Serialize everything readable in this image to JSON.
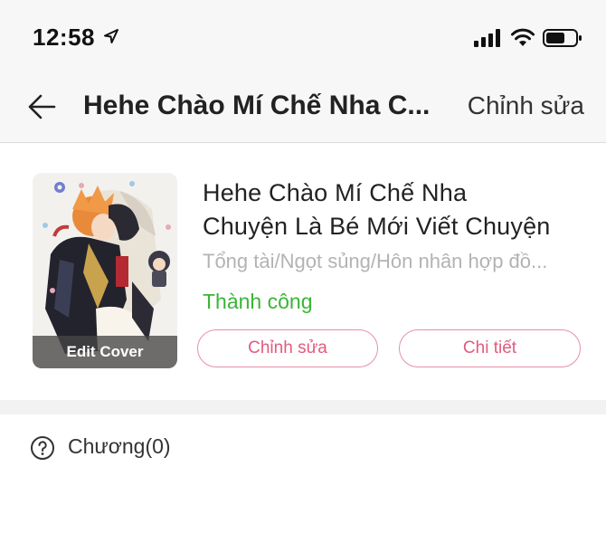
{
  "status_bar": {
    "time": "12:58",
    "icons": [
      "location-arrow-icon",
      "cellular-signal-icon",
      "wifi-icon",
      "battery-icon"
    ]
  },
  "nav": {
    "title": "Hehe Chào Mí Chế Nha C...",
    "edit_label": "Chỉnh sửa",
    "back_icon": "back-arrow-icon"
  },
  "story": {
    "title_line1": "Hehe Chào Mí Chế Nha",
    "title_line2": "Chuyện Là Bé Mới Viết Chuyện",
    "genres": "Tổng tài/Ngọt sủng/Hôn nhân hợp đồ...",
    "status": "Thành công",
    "cover_edit_label": "Edit Cover",
    "edit_button": "Chỉnh sửa",
    "detail_button": "Chi tiết"
  },
  "chapters": {
    "label": "Chương(0)",
    "help_icon": "question-circle-icon"
  },
  "colors": {
    "accent_pink": "#e25a7e",
    "status_green": "#3ab536",
    "muted_gray": "#b3b3b3"
  }
}
